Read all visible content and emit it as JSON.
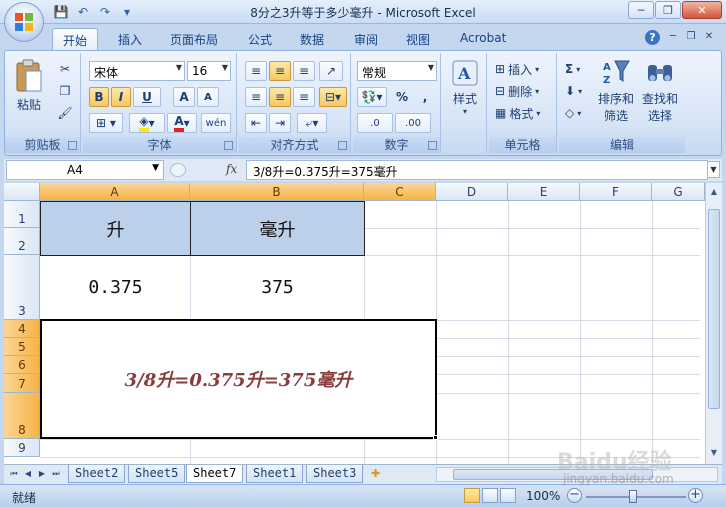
{
  "window": {
    "title": "8分之3升等于多少毫升 - Microsoft Excel",
    "minimize": "─",
    "restore": "❐",
    "close": "✕"
  },
  "qat": {
    "save": "💾",
    "undo": "↶",
    "redo": "↷",
    "more": "▾"
  },
  "ribbon": {
    "tabs": [
      "开始",
      "插入",
      "页面布局",
      "公式",
      "数据",
      "审阅",
      "视图",
      "Acrobat"
    ],
    "help": "?",
    "clipboard": {
      "label": "剪贴板",
      "paste": "粘贴"
    },
    "font": {
      "label": "字体",
      "name": "宋体",
      "size": "16",
      "bold": "B",
      "italic": "I",
      "underline": "U",
      "grow": "A",
      "shrink": "A",
      "pinyin": "wén"
    },
    "alignment": {
      "label": "对齐方式"
    },
    "number": {
      "label": "数字",
      "format": "常规",
      "percent": "%",
      "comma": ",",
      "inc": ".0",
      "dec": ".00"
    },
    "styles": {
      "label": "样式"
    },
    "cells": {
      "label": "单元格",
      "insert": "插入",
      "delete": "删除",
      "format": "格式"
    },
    "editing": {
      "label": "编辑",
      "sort": "排序和\n筛选",
      "sort1": "排序和",
      "sort2": "筛选",
      "find1": "查找和",
      "find2": "选择",
      "sum": "Σ"
    }
  },
  "formula_bar": {
    "name_box": "A4",
    "fx": "fx",
    "formula": "3/8升=0.375升=375毫升"
  },
  "grid": {
    "columns": [
      "A",
      "B",
      "C",
      "D",
      "E",
      "F",
      "G"
    ],
    "rows": [
      "1",
      "2",
      "3",
      "4",
      "5",
      "6",
      "7",
      "8",
      "9"
    ],
    "header_a": "升",
    "header_b": "毫升",
    "value_a": "0.375",
    "value_b": "375",
    "merged_text": "3/8升=0.375升=375毫升"
  },
  "sheets": {
    "tabs": [
      "Sheet2",
      "Sheet5",
      "Sheet7",
      "Sheet1",
      "Sheet3"
    ],
    "active": "Sheet7"
  },
  "status": {
    "ready": "就绪",
    "zoom": "100%",
    "minus": "−",
    "plus": "+"
  },
  "watermark": {
    "brand": "Baidu经验",
    "url": "jingyan.baidu.com"
  }
}
